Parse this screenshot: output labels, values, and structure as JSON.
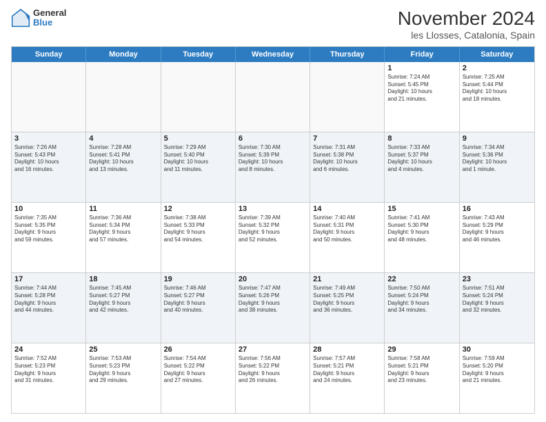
{
  "logo": {
    "general": "General",
    "blue": "Blue"
  },
  "title": "November 2024",
  "subtitle": "les Llosses, Catalonia, Spain",
  "header_days": [
    "Sunday",
    "Monday",
    "Tuesday",
    "Wednesday",
    "Thursday",
    "Friday",
    "Saturday"
  ],
  "weeks": [
    [
      {
        "day": "",
        "text": ""
      },
      {
        "day": "",
        "text": ""
      },
      {
        "day": "",
        "text": ""
      },
      {
        "day": "",
        "text": ""
      },
      {
        "day": "",
        "text": ""
      },
      {
        "day": "1",
        "text": "Sunrise: 7:24 AM\nSunset: 5:45 PM\nDaylight: 10 hours\nand 21 minutes."
      },
      {
        "day": "2",
        "text": "Sunrise: 7:25 AM\nSunset: 5:44 PM\nDaylight: 10 hours\nand 18 minutes."
      }
    ],
    [
      {
        "day": "3",
        "text": "Sunrise: 7:26 AM\nSunset: 5:43 PM\nDaylight: 10 hours\nand 16 minutes."
      },
      {
        "day": "4",
        "text": "Sunrise: 7:28 AM\nSunset: 5:41 PM\nDaylight: 10 hours\nand 13 minutes."
      },
      {
        "day": "5",
        "text": "Sunrise: 7:29 AM\nSunset: 5:40 PM\nDaylight: 10 hours\nand 11 minutes."
      },
      {
        "day": "6",
        "text": "Sunrise: 7:30 AM\nSunset: 5:39 PM\nDaylight: 10 hours\nand 8 minutes."
      },
      {
        "day": "7",
        "text": "Sunrise: 7:31 AM\nSunset: 5:38 PM\nDaylight: 10 hours\nand 6 minutes."
      },
      {
        "day": "8",
        "text": "Sunrise: 7:33 AM\nSunset: 5:37 PM\nDaylight: 10 hours\nand 4 minutes."
      },
      {
        "day": "9",
        "text": "Sunrise: 7:34 AM\nSunset: 5:36 PM\nDaylight: 10 hours\nand 1 minute."
      }
    ],
    [
      {
        "day": "10",
        "text": "Sunrise: 7:35 AM\nSunset: 5:35 PM\nDaylight: 9 hours\nand 59 minutes."
      },
      {
        "day": "11",
        "text": "Sunrise: 7:36 AM\nSunset: 5:34 PM\nDaylight: 9 hours\nand 57 minutes."
      },
      {
        "day": "12",
        "text": "Sunrise: 7:38 AM\nSunset: 5:33 PM\nDaylight: 9 hours\nand 54 minutes."
      },
      {
        "day": "13",
        "text": "Sunrise: 7:39 AM\nSunset: 5:32 PM\nDaylight: 9 hours\nand 52 minutes."
      },
      {
        "day": "14",
        "text": "Sunrise: 7:40 AM\nSunset: 5:31 PM\nDaylight: 9 hours\nand 50 minutes."
      },
      {
        "day": "15",
        "text": "Sunrise: 7:41 AM\nSunset: 5:30 PM\nDaylight: 9 hours\nand 48 minutes."
      },
      {
        "day": "16",
        "text": "Sunrise: 7:43 AM\nSunset: 5:29 PM\nDaylight: 9 hours\nand 46 minutes."
      }
    ],
    [
      {
        "day": "17",
        "text": "Sunrise: 7:44 AM\nSunset: 5:28 PM\nDaylight: 9 hours\nand 44 minutes."
      },
      {
        "day": "18",
        "text": "Sunrise: 7:45 AM\nSunset: 5:27 PM\nDaylight: 9 hours\nand 42 minutes."
      },
      {
        "day": "19",
        "text": "Sunrise: 7:46 AM\nSunset: 5:27 PM\nDaylight: 9 hours\nand 40 minutes."
      },
      {
        "day": "20",
        "text": "Sunrise: 7:47 AM\nSunset: 5:26 PM\nDaylight: 9 hours\nand 38 minutes."
      },
      {
        "day": "21",
        "text": "Sunrise: 7:49 AM\nSunset: 5:25 PM\nDaylight: 9 hours\nand 36 minutes."
      },
      {
        "day": "22",
        "text": "Sunrise: 7:50 AM\nSunset: 5:24 PM\nDaylight: 9 hours\nand 34 minutes."
      },
      {
        "day": "23",
        "text": "Sunrise: 7:51 AM\nSunset: 5:24 PM\nDaylight: 9 hours\nand 32 minutes."
      }
    ],
    [
      {
        "day": "24",
        "text": "Sunrise: 7:52 AM\nSunset: 5:23 PM\nDaylight: 9 hours\nand 31 minutes."
      },
      {
        "day": "25",
        "text": "Sunrise: 7:53 AM\nSunset: 5:23 PM\nDaylight: 9 hours\nand 29 minutes."
      },
      {
        "day": "26",
        "text": "Sunrise: 7:54 AM\nSunset: 5:22 PM\nDaylight: 9 hours\nand 27 minutes."
      },
      {
        "day": "27",
        "text": "Sunrise: 7:56 AM\nSunset: 5:22 PM\nDaylight: 9 hours\nand 26 minutes."
      },
      {
        "day": "28",
        "text": "Sunrise: 7:57 AM\nSunset: 5:21 PM\nDaylight: 9 hours\nand 24 minutes."
      },
      {
        "day": "29",
        "text": "Sunrise: 7:58 AM\nSunset: 5:21 PM\nDaylight: 9 hours\nand 23 minutes."
      },
      {
        "day": "30",
        "text": "Sunrise: 7:59 AM\nSunset: 5:20 PM\nDaylight: 9 hours\nand 21 minutes."
      }
    ]
  ]
}
